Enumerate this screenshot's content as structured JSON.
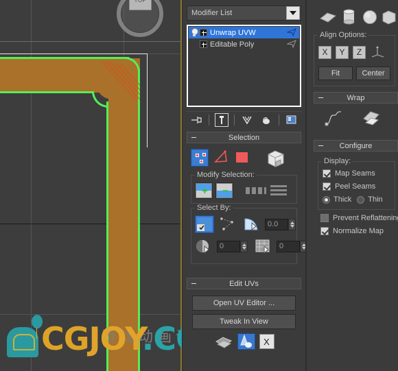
{
  "viewport": {
    "viewcube_label": "TOP",
    "model_color": "#a9712a",
    "selection_edge_color": "#55ee55",
    "seam_color": "#d94f1e"
  },
  "watermark": {
    "cg": "CG",
    "joy": "JOY",
    "dot_com": ".COM",
    "chinese": "游戏动画论坛"
  },
  "command_panel": {
    "modifier_list": {
      "label": "Modifier List",
      "arrow_icon": "chevron-down-icon"
    },
    "stack": [
      {
        "label": "Unwrap UVW",
        "selected": true,
        "has_bulb": true
      },
      {
        "label": "Editable Poly",
        "selected": false,
        "has_bulb": false
      }
    ],
    "stack_tools": [
      "pin-stack-icon",
      "show-end-result-icon",
      "make-unique-icon",
      "remove-modifier-icon",
      "configure-modifier-sets-icon"
    ],
    "selection_rollout": {
      "title": "Selection",
      "subobject_icons": [
        "vertex-icon",
        "edge-icon",
        "face-icon",
        "element-cube-icon"
      ],
      "modify_selection": {
        "label": "Modify Selection:",
        "grow_sign": "+",
        "shrink_sign": "−",
        "icons": [
          "grow-selection-icon",
          "shrink-selection-icon",
          "loop-icon",
          "ring-icon"
        ]
      },
      "select_by": {
        "label": "Select By:",
        "ignore_backfacing_icon": "ignore-backfacing-icon",
        "select_by_element_icon": "select-by-element-icon",
        "planar_angle_icon": "planar-angle-icon",
        "planar_angle_value": "0.0",
        "material_id_icon": "material-id-icon",
        "material_id_value": "0",
        "smoothing_group_icon": "smoothing-group-icon",
        "smoothing_group_value": "0"
      }
    },
    "edit_uvs_rollout": {
      "title": "Edit UVs",
      "open_uv_editor": "Open UV Editor ...",
      "tweak_in_view": "Tweak In View",
      "icons": [
        "flatten-map-icon",
        "paint-select-icon",
        "x-close-icon"
      ]
    }
  },
  "right_panel": {
    "map_shapes": [
      "planar-map-icon",
      "cylindrical-map-icon",
      "spherical-map-icon",
      "box-map-icon"
    ],
    "align_options": {
      "label": "Align Options:",
      "axes": [
        "X",
        "Y",
        "Z"
      ],
      "gizmo_icon": "axis-tripod-icon",
      "fit": "Fit",
      "center": "Center"
    },
    "wrap_rollout": {
      "title": "Wrap",
      "icons": [
        "spline-wrap-icon",
        "surface-wrap-icon"
      ]
    },
    "configure_rollout": {
      "title": "Configure",
      "display_label": "Display:",
      "checkboxes": [
        {
          "label": "Map Seams",
          "checked": true
        },
        {
          "label": "Peel Seams",
          "checked": true
        }
      ],
      "thickness": [
        {
          "label": "Thick",
          "selected": true
        },
        {
          "label": "Thin",
          "selected": false
        }
      ],
      "prevent_reflattening": {
        "label": "Prevent Reflattening",
        "checked": false
      },
      "normalize_map": {
        "label": "Normalize Map",
        "checked": true
      }
    }
  }
}
